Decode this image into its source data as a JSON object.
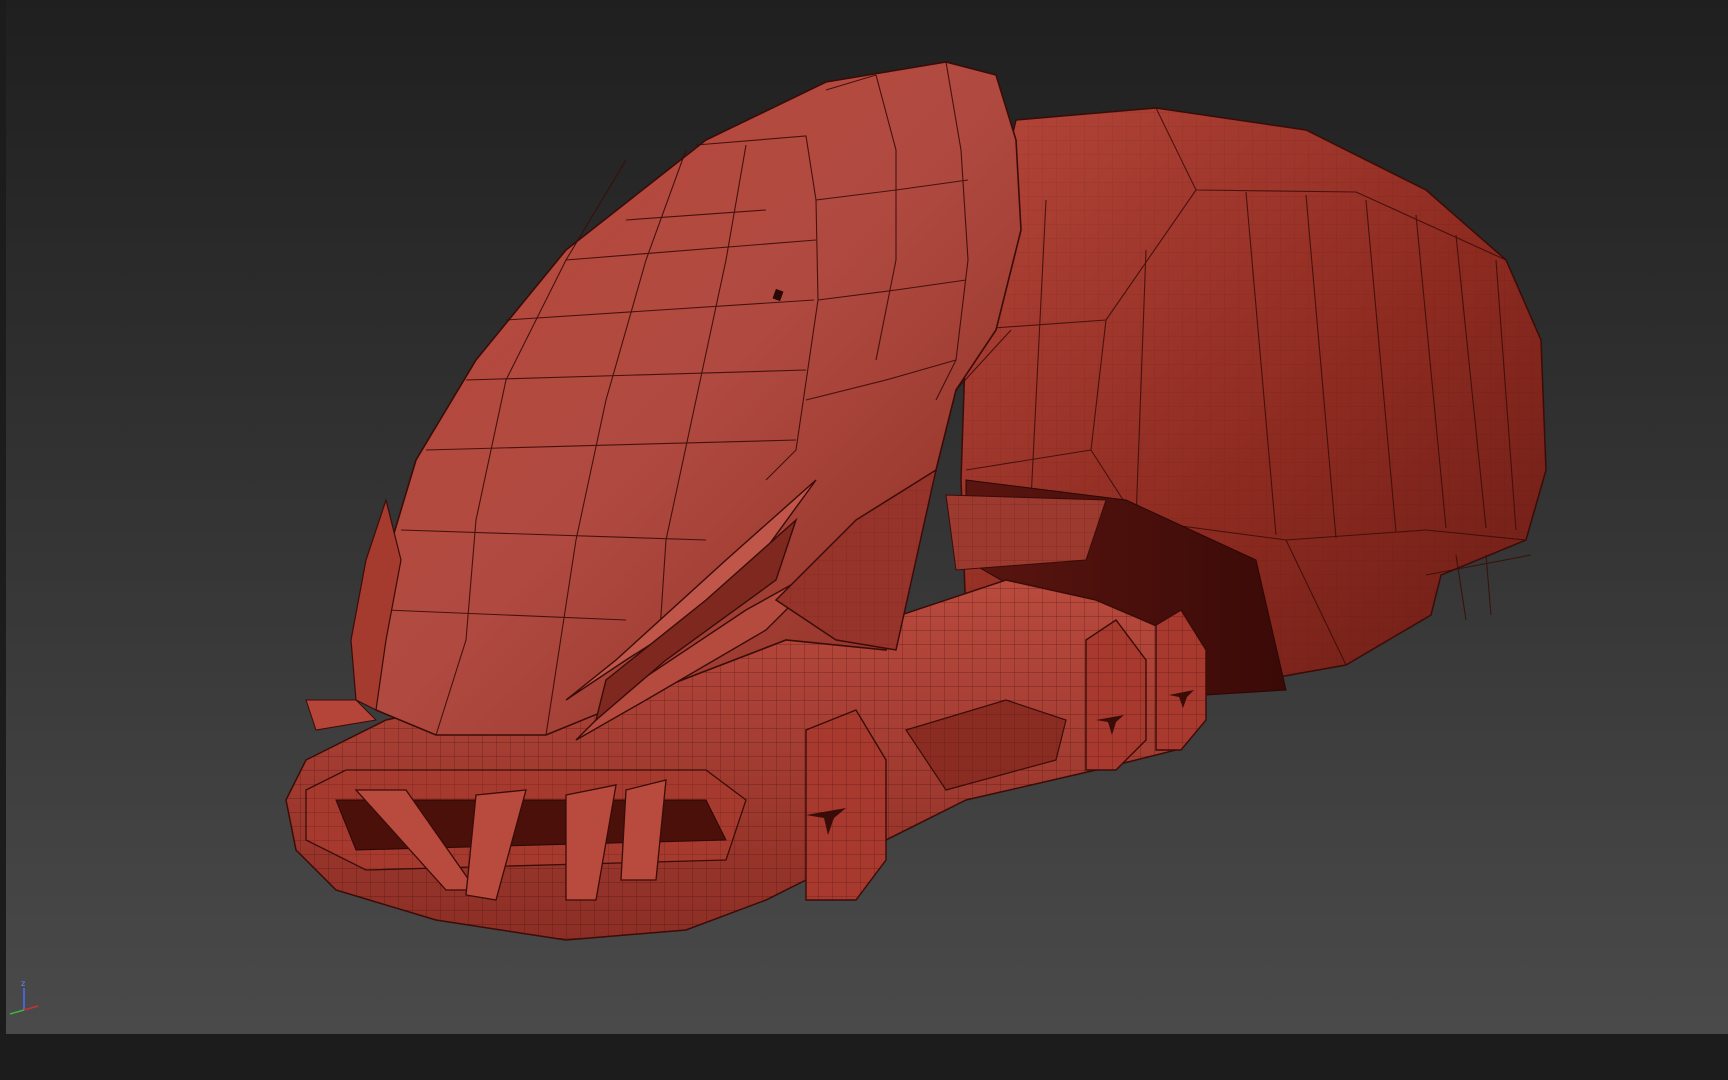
{
  "viewport": {
    "background_top": "#1f1f1f",
    "background_bottom": "#4a4a4a",
    "shading_mode": "edged faces"
  },
  "model": {
    "type": "sci-fi hover vehicle",
    "base_color": "#b8463a",
    "shadow_color": "#6e1f18",
    "wire_color": "#3a0c08"
  },
  "axis_gizmo": {
    "z_label": "z",
    "z_color": "#4a6cff",
    "x_color": "#c83232",
    "y_color": "#3cb43c"
  },
  "colors": {
    "frame": "#1c1c1c"
  }
}
